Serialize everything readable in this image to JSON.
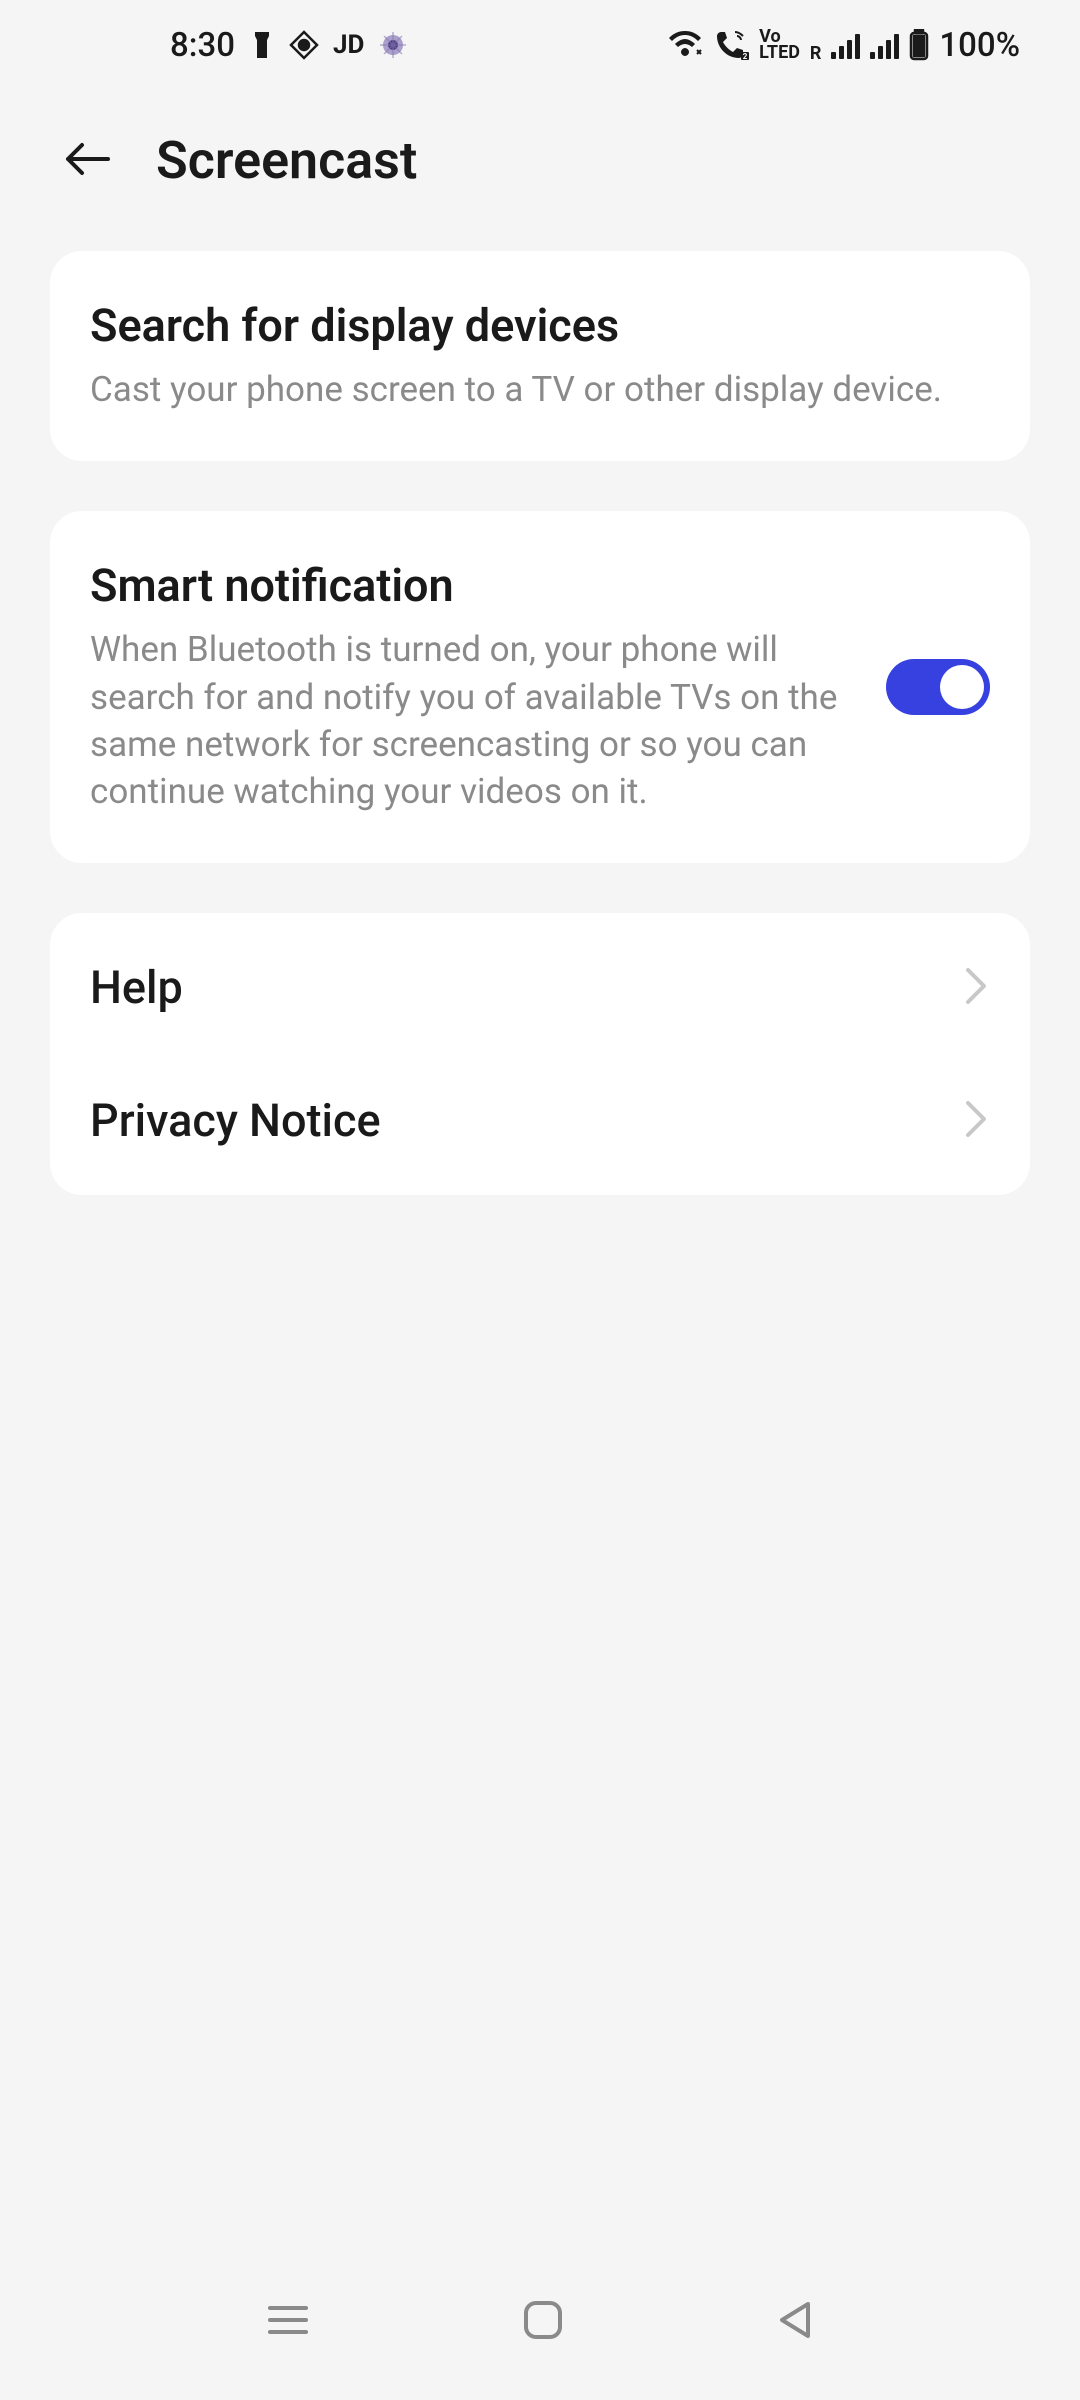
{
  "status_bar": {
    "time": "8:30",
    "jd_label": "JD",
    "volte_label": "Vo\nLTED",
    "r_label": "R",
    "battery": "100%"
  },
  "header": {
    "title": "Screencast"
  },
  "settings": {
    "search": {
      "title": "Search for display devices",
      "subtitle": "Cast your phone screen to a TV or other display device."
    },
    "smart_notification": {
      "title": "Smart notification",
      "subtitle": "When Bluetooth is turned on, your phone will search for and notify you of available TVs on the same network for screencasting or so you can continue watching your videos on it.",
      "enabled": true
    },
    "help": {
      "title": "Help"
    },
    "privacy": {
      "title": "Privacy Notice"
    }
  }
}
